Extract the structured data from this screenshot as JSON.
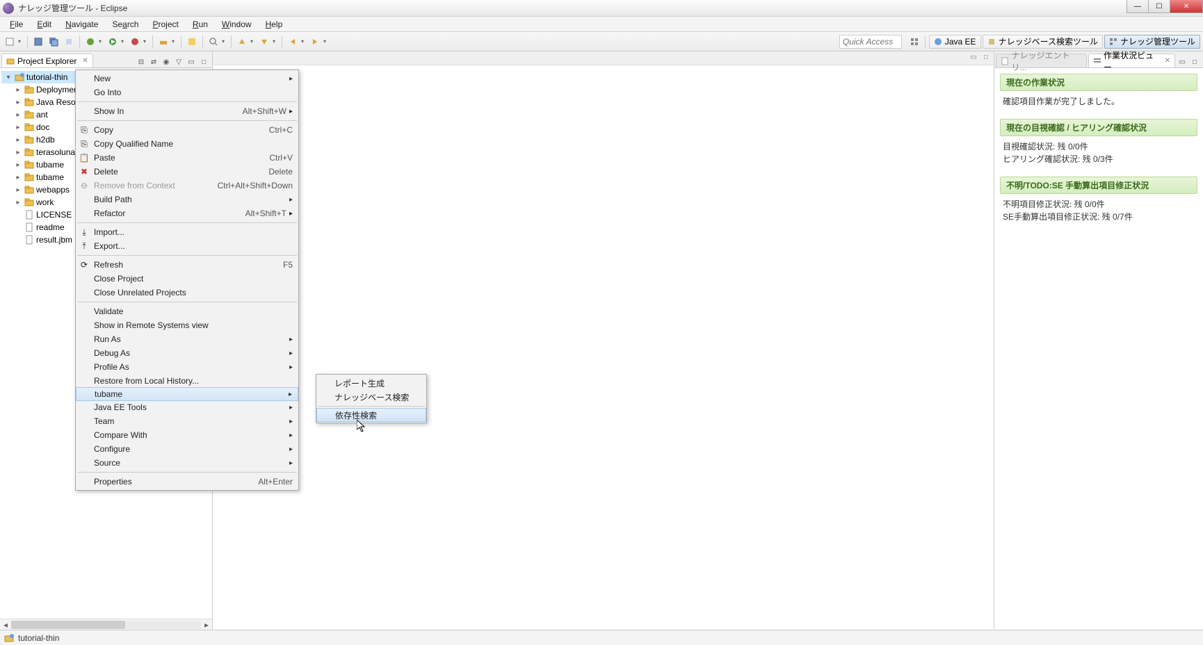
{
  "window": {
    "title": "ナレッジ管理ツール - Eclipse"
  },
  "menubar": [
    "File",
    "Edit",
    "Navigate",
    "Search",
    "Project",
    "Run",
    "Window",
    "Help"
  ],
  "quick_access_placeholder": "Quick Access",
  "perspectives": [
    {
      "label": "Java EE"
    },
    {
      "label": "ナレッジベース検索ツール"
    },
    {
      "label": "ナレッジ管理ツール"
    }
  ],
  "explorer": {
    "title": "Project Explorer",
    "root": "tutorial-thin",
    "items": [
      {
        "label": "Deployment Descriptor"
      },
      {
        "label": "Java Resources"
      },
      {
        "label": "ant"
      },
      {
        "label": "doc"
      },
      {
        "label": "h2db"
      },
      {
        "label": "terasoluna"
      },
      {
        "label": "tubame"
      },
      {
        "label": "tubame"
      },
      {
        "label": "webapps"
      },
      {
        "label": "work"
      },
      {
        "label": "LICENSE",
        "type": "file"
      },
      {
        "label": "readme",
        "type": "file"
      },
      {
        "label": "result.jbm",
        "type": "file"
      }
    ]
  },
  "right_tabs": {
    "inactive": "ナレッジエントリ...",
    "active": "作業状況ビュー"
  },
  "status_panel": {
    "sec1_title": "現在の作業状況",
    "sec1_body": "確認項目作業が完了しました。",
    "sec2_title": "現在の目視確認 / ヒアリング確認状況",
    "sec2_line1": "目視確認状況: 残 0/0件",
    "sec2_line2": "ヒアリング確認状況: 残 0/3件",
    "sec3_title": "不明/TODO:SE 手動算出項目修正状況",
    "sec3_line1": "不明項目修正状況: 残 0/0件",
    "sec3_line2": "SE手動算出項目修正状況: 残 0/7件"
  },
  "context_menu": [
    {
      "label": "New",
      "arrow": true
    },
    {
      "label": "Go Into"
    },
    {
      "sep": true
    },
    {
      "label": "Show In",
      "shortcut": "Alt+Shift+W",
      "arrow": true
    },
    {
      "sep": true
    },
    {
      "label": "Copy",
      "shortcut": "Ctrl+C",
      "icon": "copy"
    },
    {
      "label": "Copy Qualified Name",
      "icon": "copy"
    },
    {
      "label": "Paste",
      "shortcut": "Ctrl+V",
      "icon": "paste"
    },
    {
      "label": "Delete",
      "shortcut": "Delete",
      "icon": "delete"
    },
    {
      "label": "Remove from Context",
      "shortcut": "Ctrl+Alt+Shift+Down",
      "disabled": true,
      "icon": "minus"
    },
    {
      "label": "Build Path",
      "arrow": true
    },
    {
      "label": "Refactor",
      "shortcut": "Alt+Shift+T",
      "arrow": true
    },
    {
      "sep": true
    },
    {
      "label": "Import...",
      "icon": "import"
    },
    {
      "label": "Export...",
      "icon": "export"
    },
    {
      "sep": true
    },
    {
      "label": "Refresh",
      "shortcut": "F5",
      "icon": "refresh"
    },
    {
      "label": "Close Project"
    },
    {
      "label": "Close Unrelated Projects"
    },
    {
      "sep": true
    },
    {
      "label": "Validate"
    },
    {
      "label": "Show in Remote Systems view"
    },
    {
      "label": "Run As",
      "arrow": true
    },
    {
      "label": "Debug As",
      "arrow": true
    },
    {
      "label": "Profile As",
      "arrow": true
    },
    {
      "label": "Restore from Local History..."
    },
    {
      "label": "tubame",
      "arrow": true,
      "highlighted": true
    },
    {
      "label": "Java EE Tools",
      "arrow": true
    },
    {
      "label": "Team",
      "arrow": true
    },
    {
      "label": "Compare With",
      "arrow": true
    },
    {
      "label": "Configure",
      "arrow": true
    },
    {
      "label": "Source",
      "arrow": true
    },
    {
      "sep": true
    },
    {
      "label": "Properties",
      "shortcut": "Alt+Enter"
    }
  ],
  "submenu": [
    {
      "label": "レポート生成"
    },
    {
      "label": "ナレッジベース検索"
    },
    {
      "sep": true
    },
    {
      "label": "依存性検索",
      "highlighted": true
    }
  ],
  "statusbar": {
    "text": "tutorial-thin"
  }
}
